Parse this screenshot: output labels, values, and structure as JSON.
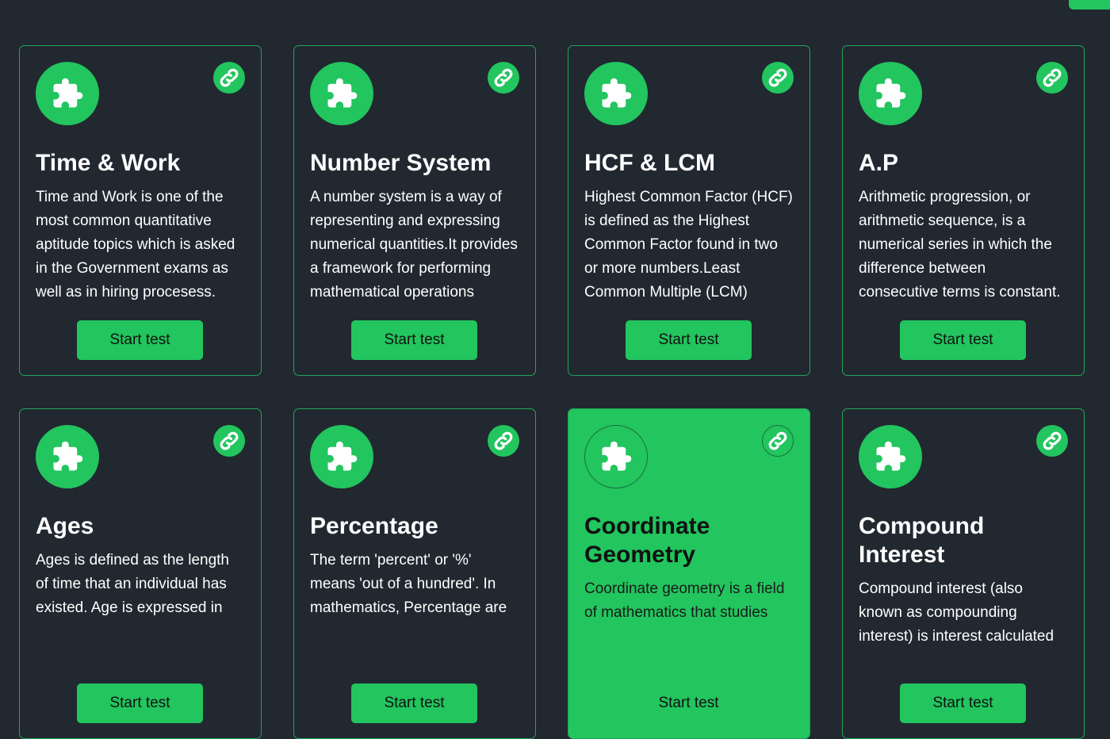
{
  "cards": [
    {
      "title": "Time & Work",
      "description": "Time and Work is one of the most common quantitative aptitude topics which is asked in the Government exams as well as in hiring procesess.",
      "button": "Start test"
    },
    {
      "title": "Number System",
      "description": "A number system is a way of representing and expressing numerical quantities.It provides a framework for performing mathematical operations",
      "button": "Start test"
    },
    {
      "title": "HCF & LCM",
      "description": "Highest Common Factor (HCF) is defined as the Highest Common Factor found in two or more numbers.Least Common Multiple (LCM)",
      "button": "Start test"
    },
    {
      "title": "A.P",
      "description": "Arithmetic progression, or arithmetic sequence, is a numerical series in which the difference between consecutive terms is constant.",
      "button": "Start test"
    },
    {
      "title": "Ages",
      "description": "Ages is defined as the length of time that an individual has existed. Age is expressed in",
      "button": "Start test"
    },
    {
      "title": "Percentage",
      "description": "The term 'percent' or '%' means 'out of a hundred'. In mathematics, Percentage are",
      "button": "Start test"
    },
    {
      "title": "Coordinate Geometry",
      "description": "Coordinate geometry is a field of mathematics that studies",
      "button": "Start test"
    },
    {
      "title": "Compound Interest",
      "description": "Compound interest (also known as compounding interest) is interest calculated",
      "button": "Start test"
    }
  ],
  "icons": {
    "topic": "puzzle-icon",
    "link": "link-icon"
  },
  "colors": {
    "background": "#212830",
    "accent": "#22c55e",
    "border": "#22a55a"
  }
}
